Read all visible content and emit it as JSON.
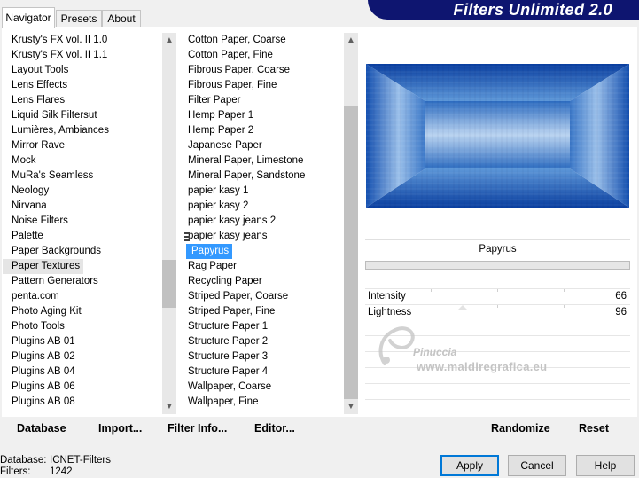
{
  "tabs": {
    "navigator": "Navigator",
    "presets": "Presets",
    "about": "About"
  },
  "banner": {
    "title": "Filters Unlimited 2.0"
  },
  "categories": [
    "Krusty's FX vol. II 1.0",
    "Krusty's FX vol. II 1.1",
    "Layout Tools",
    "Lens Effects",
    "Lens Flares",
    "Liquid Silk Filtersut",
    "Lumières, Ambiances",
    "Mirror Rave",
    "Mock",
    "MuRa's Seamless",
    "Neology",
    "Nirvana",
    "Noise Filters",
    "Palette",
    "Paper Backgrounds",
    "Paper Textures",
    "Pattern Generators",
    "penta.com",
    "Photo Aging Kit",
    "Photo Tools",
    "Plugins AB 01",
    "Plugins AB 02",
    "Plugins AB 04",
    "Plugins AB 06",
    "Plugins AB 08"
  ],
  "selected_category_index": 15,
  "filters": [
    "Cotton Paper, Coarse",
    "Cotton Paper, Fine",
    "Fibrous Paper, Coarse",
    "Fibrous Paper, Fine",
    "Filter Paper",
    "Hemp Paper 1",
    "Hemp Paper 2",
    "Japanese Paper",
    "Mineral Paper, Limestone",
    "Mineral Paper, Sandstone",
    "papier kasy 1",
    "papier kasy 2",
    "papier kasy jeans 2",
    "papier kasy jeans",
    "Papyrus",
    "Rag Paper",
    "Recycling Paper",
    "Striped Paper, Coarse",
    "Striped Paper, Fine",
    "Structure Paper 1",
    "Structure Paper 2",
    "Structure Paper 3",
    "Structure Paper 4",
    "Wallpaper, Coarse",
    "Wallpaper, Fine"
  ],
  "selected_filter_index": 14,
  "filter_name": "Papyrus",
  "params": [
    {
      "label": "Intensity",
      "value": "66"
    },
    {
      "label": "Lightness",
      "value": "96"
    }
  ],
  "watermark": {
    "name": "Pinuccia",
    "url": "www.maldiregrafica.eu"
  },
  "bottom_bar": {
    "database": "Database",
    "import": "Import...",
    "filter_info": "Filter Info...",
    "editor": "Editor...",
    "randomize": "Randomize",
    "reset": "Reset"
  },
  "status": {
    "database_label": "Database:",
    "database_value": "ICNET-Filters",
    "filters_label": "Filters:",
    "filters_value": "1242"
  },
  "buttons": {
    "apply": "Apply",
    "cancel": "Cancel",
    "help": "Help"
  },
  "colors": {
    "banner": "#0e1570",
    "selection": "#3399ff",
    "preview_dark": "#0a3fa0",
    "preview_light": "#d6e4f5"
  }
}
